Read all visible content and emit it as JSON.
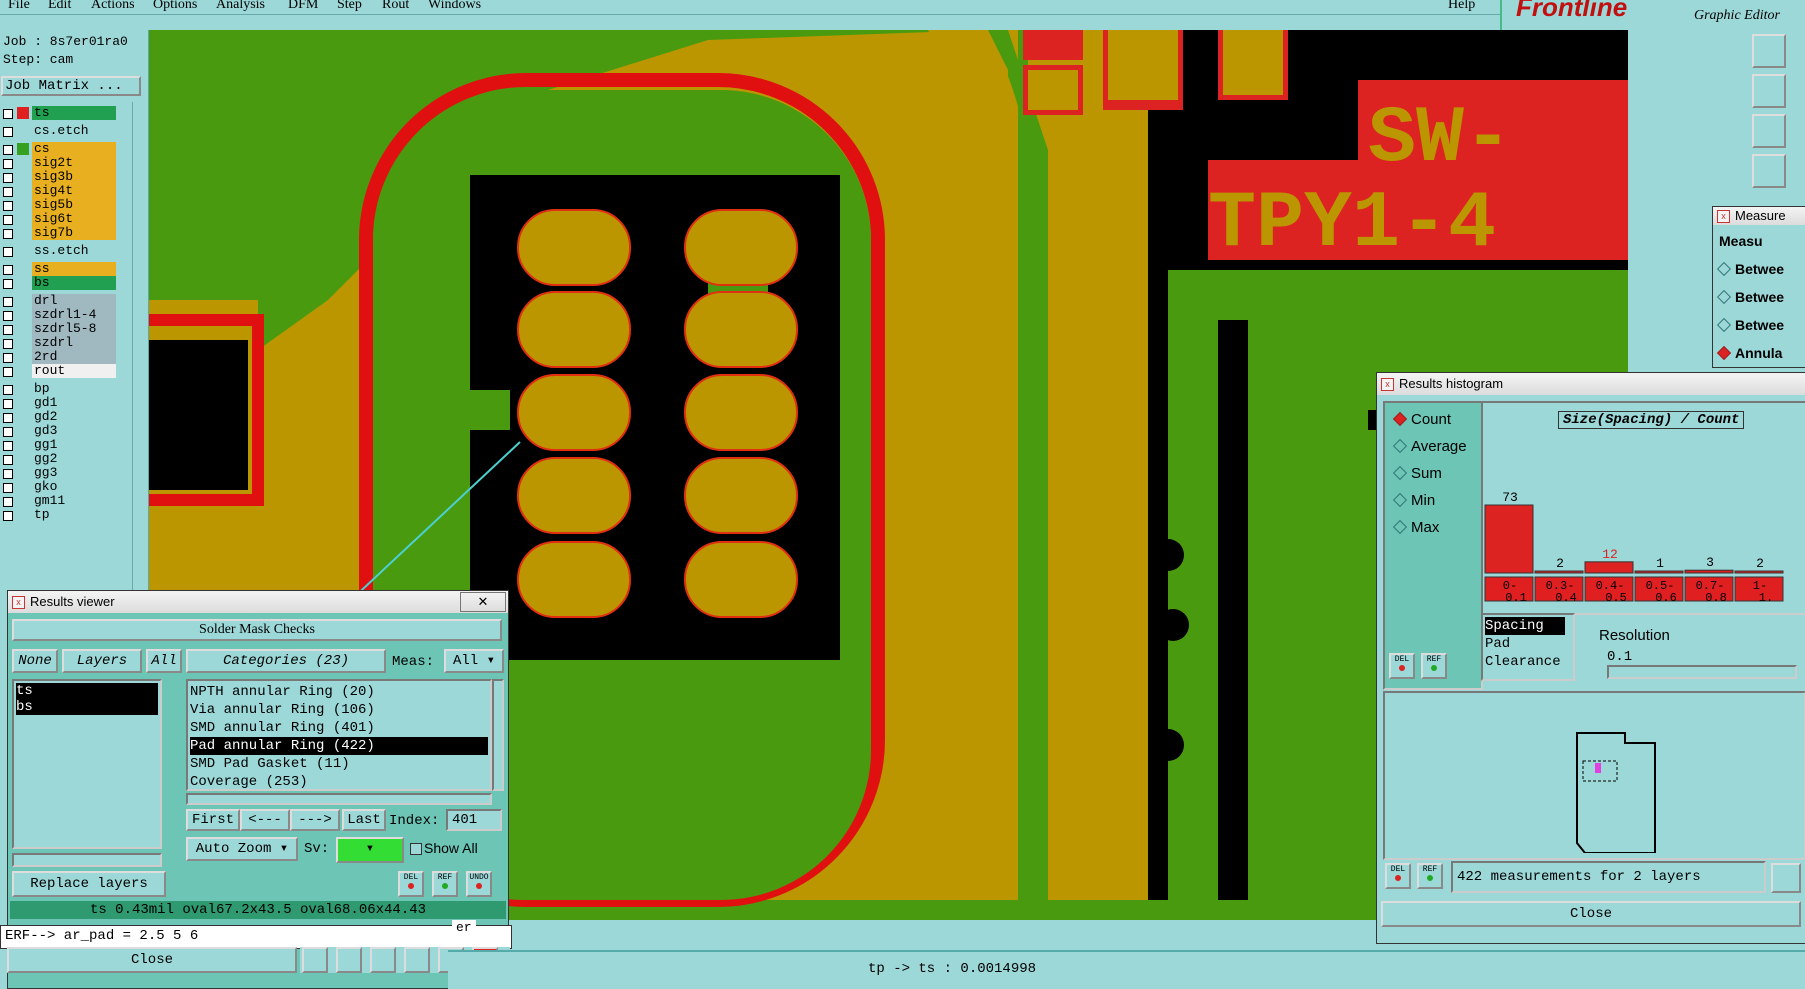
{
  "menu": [
    "File",
    "Edit",
    "Actions",
    "Options",
    "Analysis",
    "DFM",
    "Step",
    "Rout",
    "Windows"
  ],
  "help": "Help",
  "brand": {
    "logo": "Frontline",
    "subtitle": "Graphic Editor"
  },
  "job": {
    "job_label": "Job : 8s7er01ra0",
    "step_label": "Step: cam",
    "matrix_button": "Job Matrix ..."
  },
  "layers": [
    {
      "name": "ts",
      "color": "#e02020",
      "bg": "#20a050"
    },
    {
      "name": "cs.etch",
      "color": "",
      "bg": "#9dd8d8"
    },
    {
      "name": "cs",
      "color": "#36a020",
      "bg": "#e8b020"
    },
    {
      "name": "sig2t",
      "color": "",
      "bg": "#e8b020"
    },
    {
      "name": "sig3b",
      "color": "",
      "bg": "#e8b020"
    },
    {
      "name": "sig4t",
      "color": "",
      "bg": "#e8b020"
    },
    {
      "name": "sig5b",
      "color": "",
      "bg": "#e8b020"
    },
    {
      "name": "sig6t",
      "color": "",
      "bg": "#e8b020"
    },
    {
      "name": "sig7b",
      "color": "",
      "bg": "#e8b020"
    },
    {
      "name": "ss.etch",
      "color": "",
      "bg": "#9dd8d8"
    },
    {
      "name": "ss",
      "color": "",
      "bg": "#e8b020"
    },
    {
      "name": "bs",
      "color": "",
      "bg": "#20a050"
    },
    {
      "name": "drl",
      "color": "",
      "bg": "#a0b8c0"
    },
    {
      "name": "szdrl1-4",
      "color": "",
      "bg": "#a0b8c0"
    },
    {
      "name": "szdrl5-8",
      "color": "",
      "bg": "#a0b8c0"
    },
    {
      "name": "szdrl",
      "color": "",
      "bg": "#a0b8c0"
    },
    {
      "name": "2rd",
      "color": "",
      "bg": "#a0b8c0"
    },
    {
      "name": "rout",
      "color": "",
      "bg": "#f0f0f0"
    },
    {
      "name": "bp",
      "color": "",
      "bg": "#9dd8d8"
    },
    {
      "name": "gd1",
      "color": "",
      "bg": "#9dd8d8"
    },
    {
      "name": "gd2",
      "color": "",
      "bg": "#9dd8d8"
    },
    {
      "name": "gd3",
      "color": "",
      "bg": "#9dd8d8"
    },
    {
      "name": "gg1",
      "color": "",
      "bg": "#9dd8d8"
    },
    {
      "name": "gg2",
      "color": "",
      "bg": "#9dd8d8"
    },
    {
      "name": "gg3",
      "color": "",
      "bg": "#9dd8d8"
    },
    {
      "name": "gko",
      "color": "",
      "bg": "#9dd8d8"
    },
    {
      "name": "gm11",
      "color": "",
      "bg": "#9dd8d8"
    },
    {
      "name": "tp",
      "color": "",
      "bg": "#9dd8d8"
    }
  ],
  "board_text": {
    "line1": "SW-",
    "line2": "TPY1-4"
  },
  "results_viewer": {
    "title": "Results viewer",
    "header": "Solder Mask Checks",
    "none": "None",
    "layers": "Layers",
    "all": "All",
    "categories": "Categories (23)",
    "meas_label": "Meas:",
    "meas_value": "All",
    "layer_list": [
      "ts",
      "bs"
    ],
    "category_list": [
      "NPTH annular Ring (20)",
      "Via annular Ring (106)",
      "SMD annular Ring (401)",
      "Pad annular Ring (422)",
      "SMD Pad Gasket (11)",
      "Coverage (253)"
    ],
    "first": "First",
    "prev": "<---",
    "next": "--->",
    "last": "Last",
    "index_label": "Index:",
    "index_value": "401",
    "zoom": "Auto Zoom",
    "sv_label": "Sv:",
    "show_all": "Show All",
    "replace_layers": "Replace layers",
    "del": "DEL",
    "ref": "REF",
    "undo": "UNDO",
    "info": "ts 0.43mil   oval67.2x43.5   oval68.06x44.43",
    "erf": "ERF--> ar_pad = 2.5 5 6",
    "close": "Close"
  },
  "measure_window": {
    "title": "Measure",
    "header": "Measu",
    "items": [
      "Betwee",
      "Betwee",
      "Betwee",
      "Annula"
    ]
  },
  "histogram": {
    "title": "Results histogram",
    "radios": [
      "Count",
      "Average",
      "Sum",
      "Min",
      "Max"
    ],
    "chart_title": "Size(Spacing) / Count",
    "bins": [
      "0-0.1",
      "0.3-0.4",
      "0.4-0.5",
      "0.5-0.6",
      "0.7-0.8",
      "1-1."
    ],
    "counts": [
      73,
      2,
      12,
      1,
      3,
      2
    ],
    "count_colors": [
      "#000",
      "#000",
      "#d22",
      "#000",
      "#000",
      "#000"
    ],
    "types": [
      "Spacing",
      "Pad",
      "Clearance"
    ],
    "resolution_label": "Resolution",
    "resolution_value": "0.1",
    "summary": "422 measurements for 2 layers",
    "close": "Close"
  },
  "status": {
    "text": "tp -> ts : 0.0014998",
    "partial": "er"
  }
}
